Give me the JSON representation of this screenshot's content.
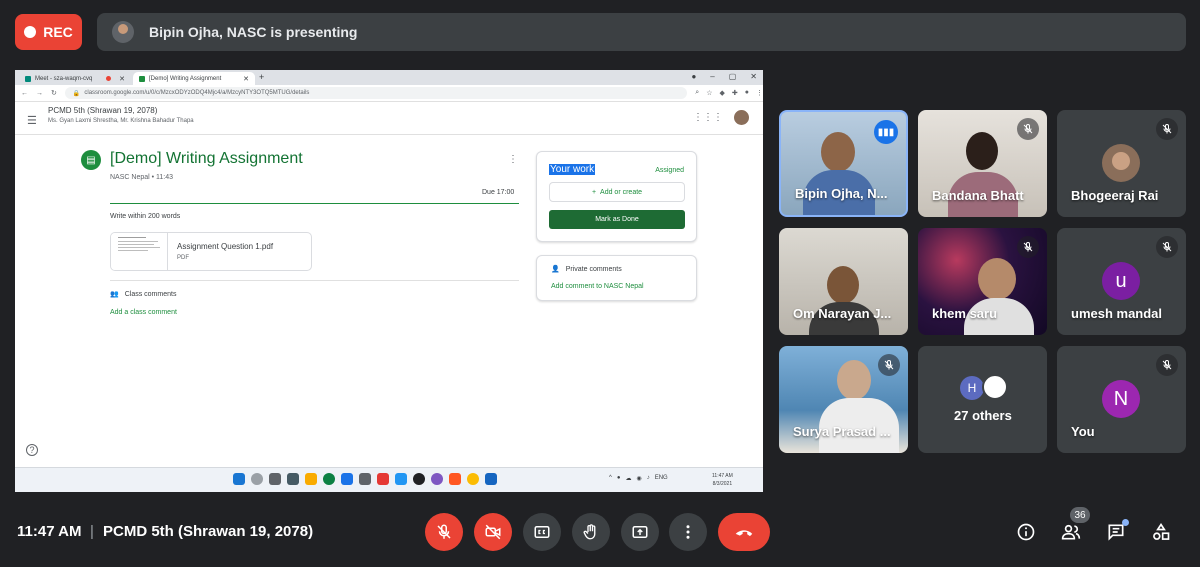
{
  "recording": {
    "label": "REC"
  },
  "presenting": {
    "text": "Bipin Ojha, NASC is presenting"
  },
  "browser": {
    "tabs": [
      {
        "title": "Meet - sza-waqm-cvq"
      },
      {
        "title": "[Demo] Writing Assignment"
      }
    ],
    "url": "classroom.google.com/u/0/c/MzcxODYzODQ4Mjc4/a/MzcyNTY3OTQ5MTUG/details"
  },
  "classroom": {
    "class_title": "PCMD 5th (Shrawan 19, 2078)",
    "teachers": "Ms. Gyan Laxmi Shrestha, Mr. Krishna Bahadur Thapa",
    "assignment": {
      "title": "[Demo] Writing Assignment",
      "posted": "NASC Nepal • 11:43",
      "due": "Due 17:00",
      "instructions": "Write within 200 words",
      "attachment_name": "Assignment Question 1.pdf",
      "attachment_type": "PDF",
      "class_comments": "Class comments",
      "add_class_comment": "Add a class comment"
    },
    "your_work": {
      "label": "Your work",
      "status": "Assigned",
      "add_create": "Add or create",
      "mark_done": "Mark as Done"
    },
    "private_comments": {
      "label": "Private comments",
      "add": "Add comment to NASC Nepal"
    }
  },
  "taskbar": {
    "tray": "ENG",
    "time": "11:47 AM",
    "date": "8/3/2021"
  },
  "participants": [
    {
      "name": "Bipin Ojha, N..."
    },
    {
      "name": "Bandana Bhatt"
    },
    {
      "name": "Bhogeeraj Rai"
    },
    {
      "name": "Om Narayan J..."
    },
    {
      "name": "khem saru"
    },
    {
      "name": "umesh mandal",
      "initial": "u"
    },
    {
      "name": "Surya Prasad ..."
    },
    {
      "name": "27 others",
      "initial": "H"
    },
    {
      "name": "You",
      "initial": "N"
    }
  ],
  "footer": {
    "time": "11:47 AM",
    "separator": "|",
    "meeting": "PCMD 5th (Shrawan 19, 2078)",
    "people_count": "36"
  },
  "colors": {
    "red": "#ea4335",
    "button": "#3c4043",
    "tile": "#3c4043",
    "background": "#202124",
    "classroom_green": "#1e8e3e"
  }
}
